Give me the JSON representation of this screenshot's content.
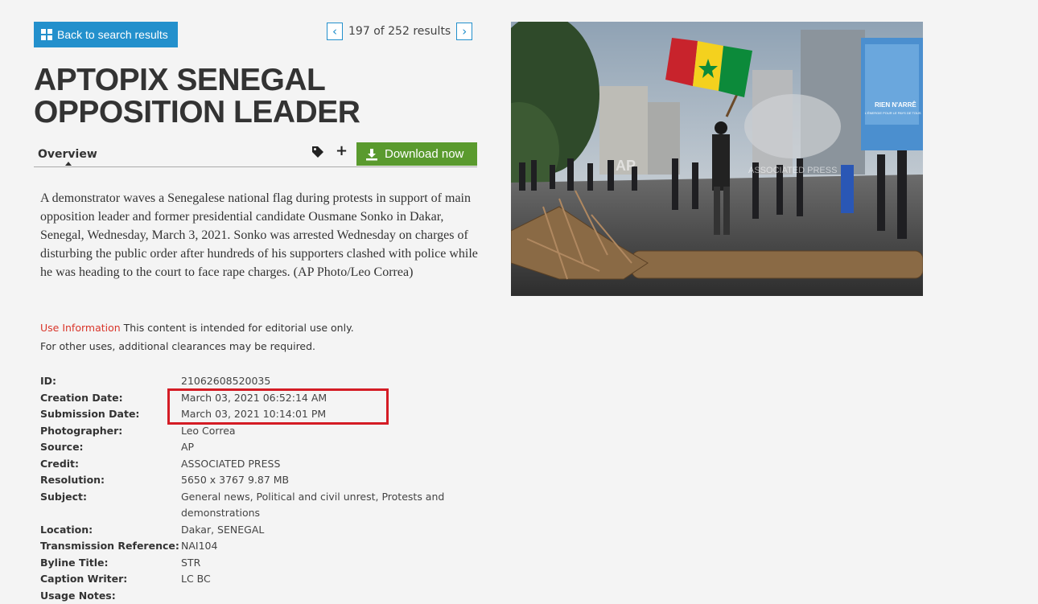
{
  "nav": {
    "back_label": "Back to search results",
    "current": "197",
    "of_word": "of",
    "total": "252",
    "results_word": "results"
  },
  "title": "APTOPIX SENEGAL OPPOSITION LEADER",
  "tabs": {
    "overview": "Overview"
  },
  "actions": {
    "download_label": "Download now"
  },
  "caption": "A demonstrator waves a Senegalese national flag during protests in support of main opposition leader and former presidential candidate Ousmane Sonko in Dakar, Senegal, Wednesday, March 3, 2021. Sonko was arrested Wednesday on charges of disturbing the public order after hundreds of his supporters clashed with police while he was heading to the court to face rape charges. (AP Photo/Leo Correa)",
  "use_info": {
    "link": "Use Information",
    "text1": " This content is intended for editorial use only.",
    "text2": "For other uses, additional clearances may be required."
  },
  "metadata": [
    {
      "label": "ID:",
      "value": "21062608520035"
    },
    {
      "label": "Creation Date:",
      "value": "March 03, 2021 06:52:14 AM"
    },
    {
      "label": "Submission Date:",
      "value": "March 03, 2021 10:14:01 PM"
    },
    {
      "label": "Photographer:",
      "value": "Leo Correa"
    },
    {
      "label": "Source:",
      "value": "AP"
    },
    {
      "label": "Credit:",
      "value": "ASSOCIATED PRESS"
    },
    {
      "label": "Resolution:",
      "value": "5650 x 3767 9.87 MB"
    },
    {
      "label": "Subject:",
      "value": "General news, Political and civil unrest, Protests and demonstrations"
    },
    {
      "label": "Location:",
      "value": "Dakar, SENEGAL"
    },
    {
      "label": "Transmission Reference:",
      "value": "NAI104"
    },
    {
      "label": "Byline Title:",
      "value": "STR"
    },
    {
      "label": "Caption Writer:",
      "value": "LC BC"
    },
    {
      "label": "Usage Notes:",
      "value": ""
    }
  ],
  "photo": {
    "watermark_ap": "AP",
    "watermark_text": "ASSOCIATED PRESS",
    "billboard_text1": "RIEN N'ARRÊ",
    "billboard_text2": "L'ÉNERGIE POUR LE PAYS DE TOUS"
  },
  "colors": {
    "accent_blue": "#2390cc",
    "download_green": "#5a9a2e",
    "highlight_red": "#d41c25",
    "link_red": "#d9352a"
  },
  "icons": [
    "grid-icon",
    "chevron-left-icon",
    "chevron-right-icon",
    "tag-icon",
    "plus-icon",
    "download-icon"
  ]
}
